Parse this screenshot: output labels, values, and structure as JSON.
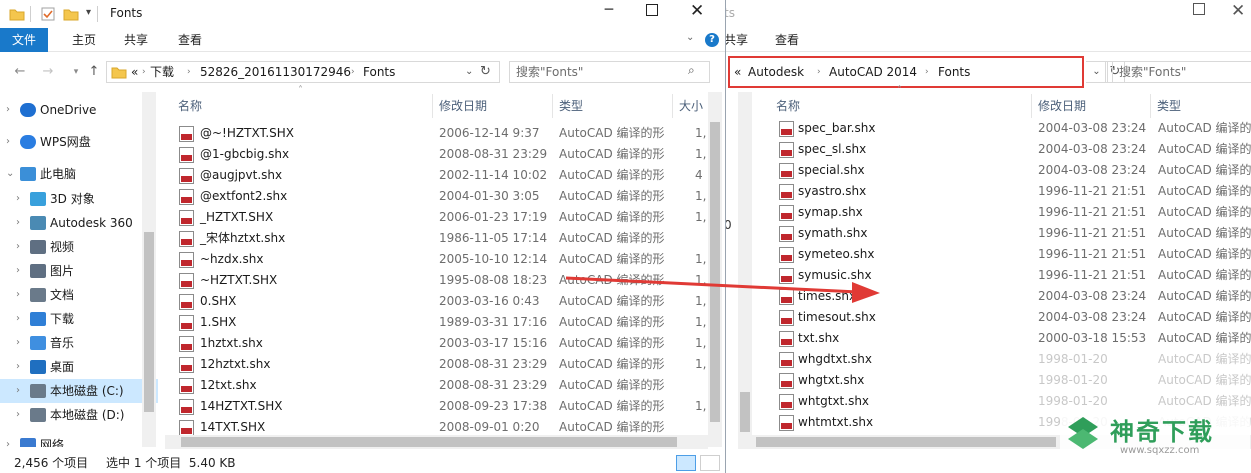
{
  "left": {
    "title": "Fonts",
    "ribbon_tabs": [
      "文件",
      "主页",
      "共享",
      "查看"
    ],
    "address": {
      "overflow": "«",
      "crumbs": [
        "下载",
        "52826_20161130172946",
        "Fonts"
      ]
    },
    "search_placeholder": "搜索\"Fonts\"",
    "nav": [
      {
        "label": "OneDrive",
        "icon": "onedrive-icon"
      },
      {
        "label": "WPS网盘",
        "icon": "wps-cloud-icon"
      },
      {
        "label": "此电脑",
        "icon": "computer-icon"
      },
      {
        "label": "3D 对象",
        "icon": "3d-objects-icon"
      },
      {
        "label": "Autodesk 360",
        "icon": "autodesk-360-icon"
      },
      {
        "label": "视频",
        "icon": "video-folder-icon"
      },
      {
        "label": "图片",
        "icon": "pictures-folder-icon"
      },
      {
        "label": "文档",
        "icon": "documents-folder-icon"
      },
      {
        "label": "下载",
        "icon": "downloads-folder-icon"
      },
      {
        "label": "音乐",
        "icon": "music-folder-icon"
      },
      {
        "label": "桌面",
        "icon": "desktop-folder-icon"
      },
      {
        "label": "本地磁盘 (C:)",
        "icon": "drive-c-icon"
      },
      {
        "label": "本地磁盘 (D:)",
        "icon": "drive-d-icon"
      },
      {
        "label": "网络",
        "icon": "network-icon"
      }
    ],
    "columns": {
      "name": "名称",
      "date": "修改日期",
      "type": "类型",
      "size": "大小"
    },
    "files": [
      {
        "name": "@~!HZTXT.SHX",
        "date": "2006-12-14 9:37",
        "type": "AutoCAD 编译的形",
        "size": "1,"
      },
      {
        "name": "@1-gbcbig.shx",
        "date": "2008-08-31 23:29",
        "type": "AutoCAD 编译的形",
        "size": "1,"
      },
      {
        "name": "@augjpvt.shx",
        "date": "2002-11-14 10:02",
        "type": "AutoCAD 编译的形",
        "size": "4"
      },
      {
        "name": "@extfont2.shx",
        "date": "2004-01-30 3:05",
        "type": "AutoCAD 编译的形",
        "size": "1,"
      },
      {
        "name": "_HZTXT.SHX",
        "date": "2006-01-23 17:19",
        "type": "AutoCAD 编译的形",
        "size": "1,"
      },
      {
        "name": "_宋体hztxt.shx",
        "date": "1986-11-05 17:14",
        "type": "AutoCAD 编译的形",
        "size": ""
      },
      {
        "name": "~hzdx.shx",
        "date": "2005-10-10 12:14",
        "type": "AutoCAD 编译的形",
        "size": "1,"
      },
      {
        "name": "~HZTXT.SHX",
        "date": "1995-08-08 18:23",
        "type": "AutoCAD 编译的形",
        "size": "1,"
      },
      {
        "name": "0.SHX",
        "date": "2003-03-16 0:43",
        "type": "AutoCAD 编译的形",
        "size": "1,"
      },
      {
        "name": "1.SHX",
        "date": "1989-03-31 17:16",
        "type": "AutoCAD 编译的形",
        "size": "1,"
      },
      {
        "name": "1hztxt.shx",
        "date": "2003-03-17 15:16",
        "type": "AutoCAD 编译的形",
        "size": "1,"
      },
      {
        "name": "12hztxt.shx",
        "date": "2008-08-31 23:29",
        "type": "AutoCAD 编译的形",
        "size": "1,"
      },
      {
        "name": "12txt.shx",
        "date": "2008-08-31 23:29",
        "type": "AutoCAD 编译的形",
        "size": ""
      },
      {
        "name": "14HZTXT.SHX",
        "date": "2008-09-23 17:38",
        "type": "AutoCAD 编译的形",
        "size": "1,"
      },
      {
        "name": "14TXT.SHX",
        "date": "2008-09-01 0:20",
        "type": "AutoCAD 编译的形",
        "size": ""
      }
    ],
    "status": {
      "count": "2,456 个项目",
      "selected": "选中 1 个项目  5.40 KB"
    }
  },
  "right": {
    "title": "Fonts",
    "ribbon_tabs": [
      "共享",
      "查看"
    ],
    "address": {
      "overflow": "«",
      "crumbs": [
        "Autodesk",
        "AutoCAD 2014",
        "Fonts"
      ]
    },
    "search_placeholder": "搜索\"Fonts\"",
    "columns": {
      "name": "名称",
      "date": "修改日期",
      "type": "类型"
    },
    "files": [
      {
        "name": "spec_bar.shx",
        "date": "2004-03-08 23:24",
        "type": "AutoCAD 编译的形"
      },
      {
        "name": "spec_sl.shx",
        "date": "2004-03-08 23:24",
        "type": "AutoCAD 编译的形"
      },
      {
        "name": "special.shx",
        "date": "2004-03-08 23:24",
        "type": "AutoCAD 编译的形"
      },
      {
        "name": "syastro.shx",
        "date": "1996-11-21 21:51",
        "type": "AutoCAD 编译的形"
      },
      {
        "name": "symap.shx",
        "date": "1996-11-21 21:51",
        "type": "AutoCAD 编译的形"
      },
      {
        "name": "symath.shx",
        "date": "1996-11-21 21:51",
        "type": "AutoCAD 编译的形"
      },
      {
        "name": "symeteo.shx",
        "date": "1996-11-21 21:51",
        "type": "AutoCAD 编译的形"
      },
      {
        "name": "symusic.shx",
        "date": "1996-11-21 21:51",
        "type": "AutoCAD 编译的形"
      },
      {
        "name": "times.shx",
        "date": "2004-03-08 23:24",
        "type": "AutoCAD 编译的形"
      },
      {
        "name": "timesout.shx",
        "date": "2004-03-08 23:24",
        "type": "AutoCAD 编译的形"
      },
      {
        "name": "txt.shx",
        "date": "2000-03-18 15:53",
        "type": "AutoCAD 编译的形"
      },
      {
        "name": "whgdtxt.shx",
        "date": "1998-01-20",
        "type": "AutoCAD 编译的形"
      },
      {
        "name": "whgtxt.shx",
        "date": "1998-01-20",
        "type": "AutoCAD 编译的形"
      },
      {
        "name": "whtgtxt.shx",
        "date": "1998-01-20",
        "type": "AutoCAD 编译的形"
      },
      {
        "name": "whtmtxt.shx",
        "date": "1998-01-20",
        "type": "AutoCAD 编译的形"
      }
    ]
  },
  "watermark": {
    "brand": "神奇下载",
    "url": "www.sqxzz.com"
  },
  "colors": {
    "accent": "#1979ca",
    "highlight": "#e03a35",
    "selected": "#cce8ff",
    "icon_red": "#c0272d"
  }
}
